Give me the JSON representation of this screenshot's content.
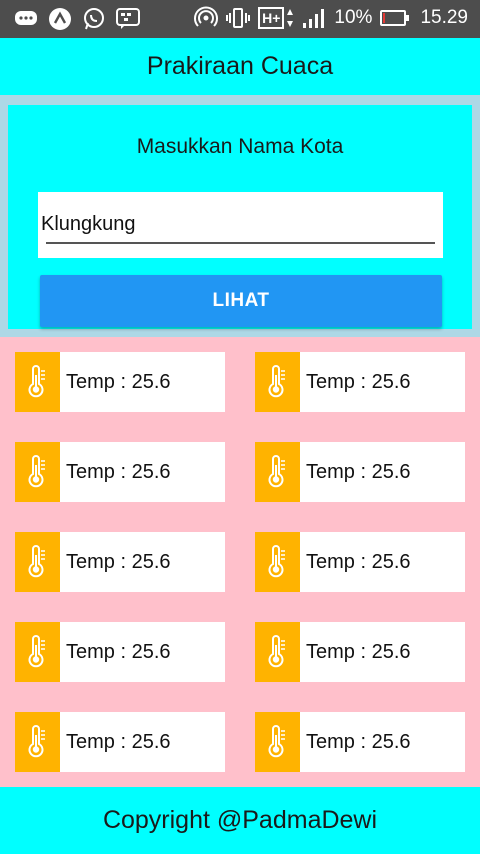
{
  "status_bar": {
    "battery": "10%",
    "battery_level": 0.1,
    "time": "15.29",
    "network": "H+",
    "icons": [
      "chat-icon",
      "app-a-icon",
      "whatsapp-icon",
      "bbm-icon",
      "hotspot-icon",
      "vibrate-icon",
      "network-icon",
      "signal-icon",
      "battery-icon"
    ]
  },
  "app_bar": {
    "title": "Prakiraan Cuaca"
  },
  "form": {
    "label": "Masukkan Nama Kota",
    "city_value": "Klungkung",
    "button_label": "LIHAT"
  },
  "cards": [
    {
      "text": "Temp : 25.6",
      "icon": "thermometer-icon"
    },
    {
      "text": "Temp : 25.6",
      "icon": "thermometer-icon"
    },
    {
      "text": "Temp : 25.6",
      "icon": "thermometer-icon"
    },
    {
      "text": "Temp : 25.6",
      "icon": "thermometer-icon"
    },
    {
      "text": "Temp : 25.6",
      "icon": "thermometer-icon"
    },
    {
      "text": "Temp : 25.6",
      "icon": "thermometer-icon"
    },
    {
      "text": "Temp : 25.6",
      "icon": "thermometer-icon"
    },
    {
      "text": "Temp : 25.6",
      "icon": "thermometer-icon"
    },
    {
      "text": "Temp : 25.6",
      "icon": "thermometer-icon"
    },
    {
      "text": "Temp : 25.6",
      "icon": "thermometer-icon"
    }
  ],
  "footer": {
    "text": "Copyright @PadmaDewi"
  },
  "colors": {
    "app_bar": "#00ffff",
    "panel_border": "#add8e6",
    "background": "#ffc0cb",
    "button": "#2196f3",
    "icon_tile": "#ffb300"
  }
}
